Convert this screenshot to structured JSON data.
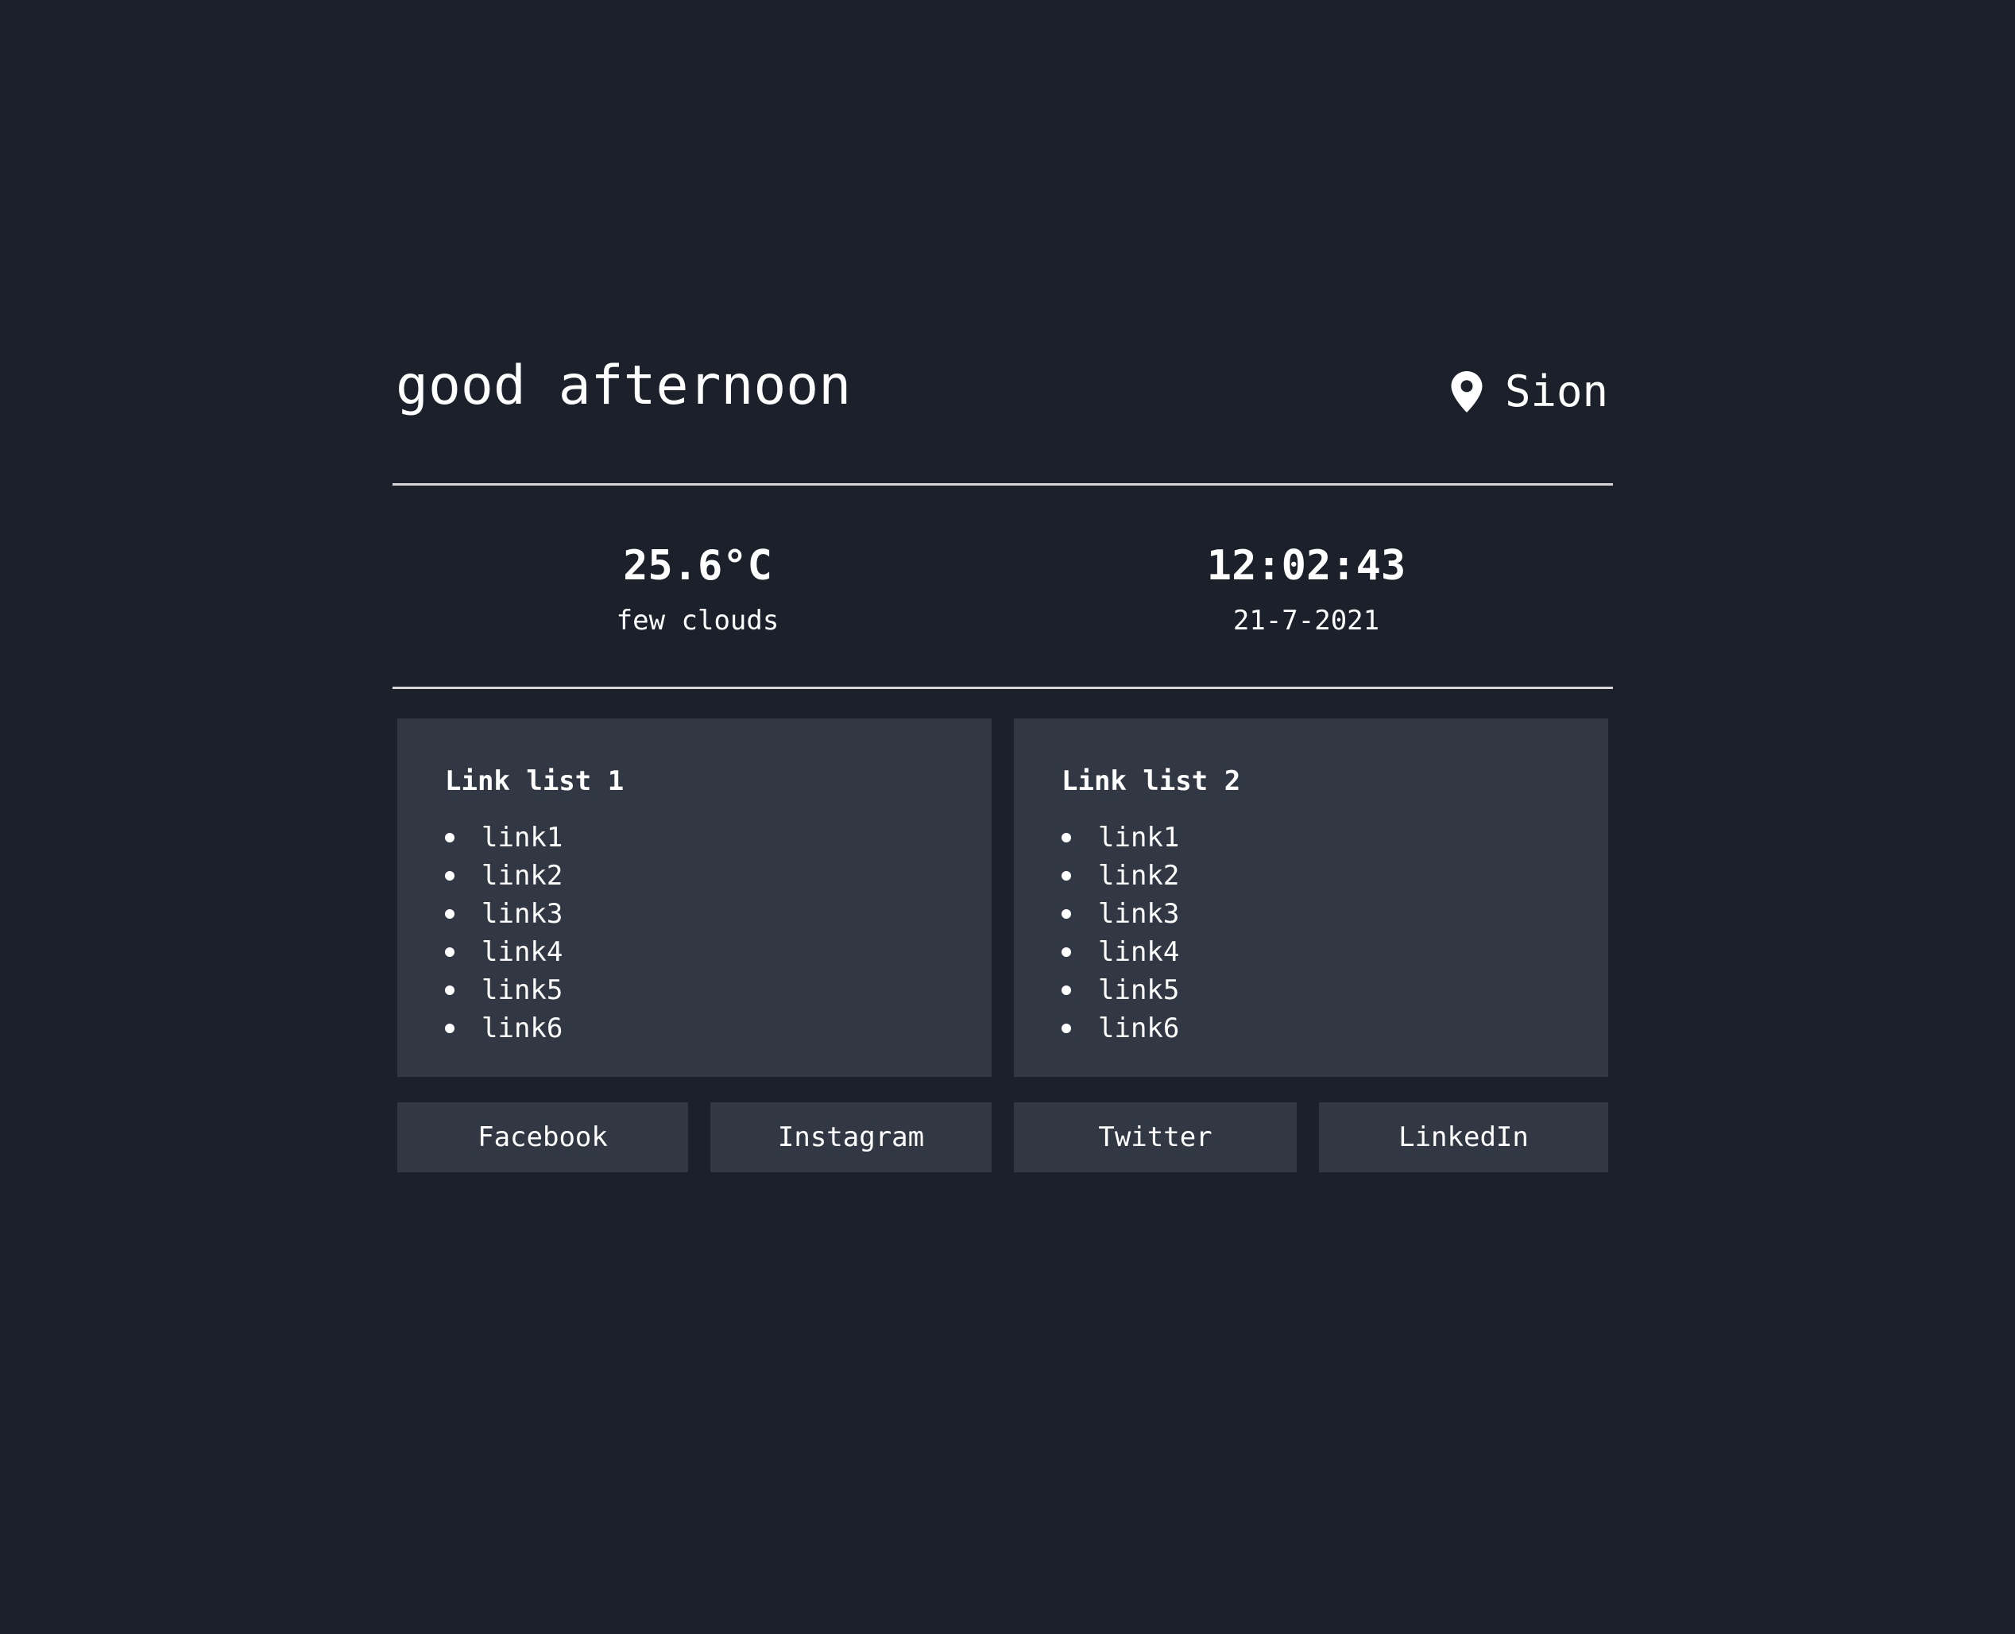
{
  "header": {
    "greeting": "good afternoon",
    "location": "Sion",
    "location_icon": "map-pin-icon"
  },
  "weather": {
    "temperature": "25.6°C",
    "description": "few clouds"
  },
  "clock": {
    "time": "12:02:43",
    "date": "21-7-2021"
  },
  "link_lists": [
    {
      "title": "Link list 1",
      "items": [
        "link1",
        "link2",
        "link3",
        "link4",
        "link5",
        "link6"
      ]
    },
    {
      "title": "Link list 2",
      "items": [
        "link1",
        "link2",
        "link3",
        "link4",
        "link5",
        "link6"
      ]
    }
  ],
  "social": {
    "facebook": "Facebook",
    "instagram": "Instagram",
    "twitter": "Twitter",
    "linkedin": "LinkedIn"
  },
  "colors": {
    "background": "#1b202b",
    "card": "#323843",
    "text": "#ffffff",
    "divider": "#d8d8d8"
  }
}
